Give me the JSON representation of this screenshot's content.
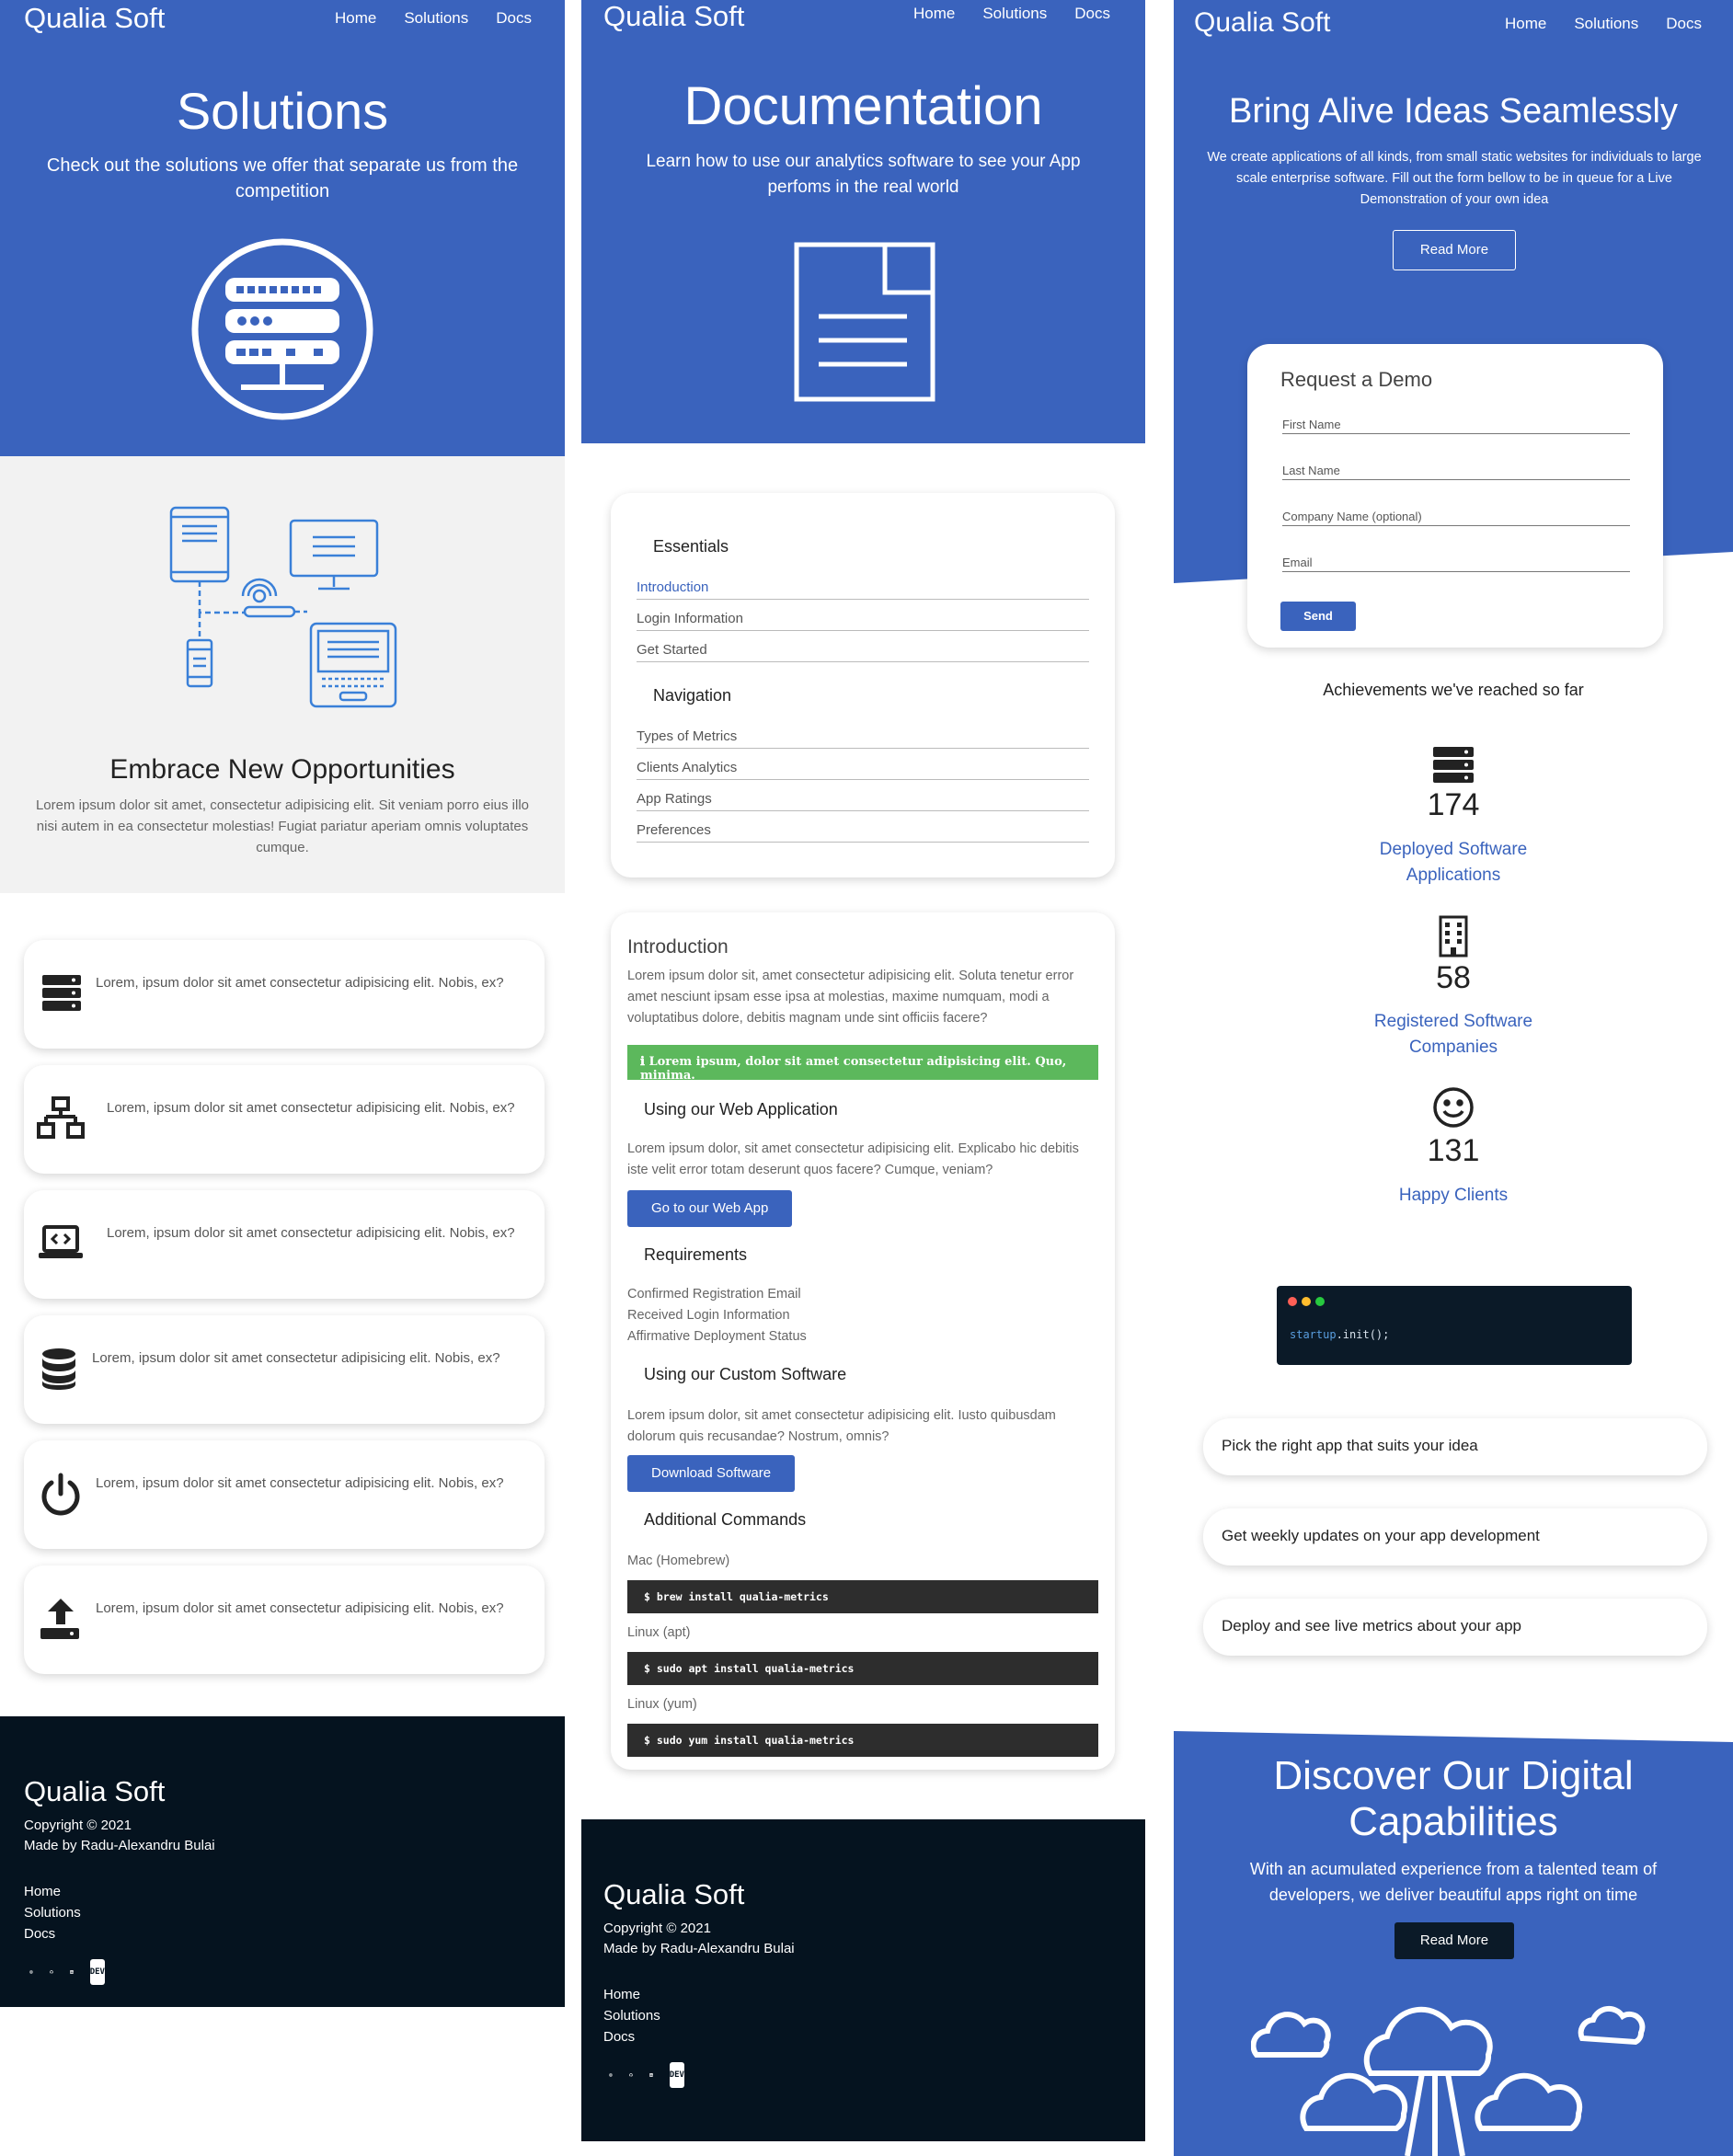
{
  "brand": "Qualia Soft",
  "nav": [
    "Home",
    "Solutions",
    "Docs"
  ],
  "colors": {
    "primary": "#3a63bd",
    "footer": "#05131f",
    "alert": "#5cb85c",
    "light_gray": "#f2f2f2"
  },
  "solutions_page": {
    "hero_title": "Solutions",
    "hero_subtitle": "Check out the solutions we offer that separate us from the competition",
    "hero_icon": "server-rack-circle-icon",
    "illustration": "connected-devices-icon",
    "section_title": "Embrace New Opportunities",
    "section_text": "Lorem ipsum dolor sit amet, consectetur adipisicing elit. Sit veniam porro eius illo nisi autem in ea consectetur molestias! Fugiat pariatur aperiam omnis voluptates cumque.",
    "features": [
      {
        "icon": "server-icon",
        "text": "Lorem, ipsum dolor sit amet consectetur adipisicing elit. Nobis, ex?"
      },
      {
        "icon": "network-icon",
        "text": "Lorem, ipsum dolor sit amet consectetur adipisicing elit. Nobis, ex?"
      },
      {
        "icon": "laptop-code-icon",
        "text": "Lorem, ipsum dolor sit amet consectetur adipisicing elit. Nobis, ex?"
      },
      {
        "icon": "database-icon",
        "text": "Lorem, ipsum dolor sit amet consectetur adipisicing elit. Nobis, ex?"
      },
      {
        "icon": "power-icon",
        "text": "Lorem, ipsum dolor sit amet consectetur adipisicing elit. Nobis, ex?"
      },
      {
        "icon": "upload-icon",
        "text": "Lorem, ipsum dolor sit amet consectetur adipisicing elit. Nobis, ex?"
      }
    ]
  },
  "docs_page": {
    "hero_title": "Documentation",
    "hero_subtitle": "Learn how to use our analytics software to see your App perfoms in the real world",
    "hero_icon": "document-icon",
    "sidebar": {
      "essentials_title": "Essentials",
      "essentials": [
        "Introduction",
        "Login Information",
        "Get Started"
      ],
      "navigation_title": "Navigation",
      "navigation": [
        "Types of Metrics",
        "Clients Analytics",
        "App Ratings",
        "Preferences"
      ]
    },
    "intro_title": "Introduction",
    "intro_text": "Lorem ipsum dolor sit, amet consectetur adipisicing elit. Soluta tenetur error amet nesciunt ipsam esse ipsa at molestias, maxime numquam, modi a voluptatibus dolore, debitis magnam unde sint officiis facere?",
    "alert_icon": "info-icon",
    "alert_text": "Lorem ipsum, dolor sit amet consectetur adipisicing elit. Quo, minima.",
    "web_title": "Using our Web Application",
    "web_text": "Lorem ipsum dolor, sit amet consectetur adipisicing elit. Explicabo hic debitis iste velit error totam deserunt quos facere? Cumque, veniam?",
    "web_button": "Go to our Web App",
    "req_title": "Requirements",
    "requirements": [
      "Confirmed Registration Email",
      "Received Login Information",
      "Affirmative Deployment Status"
    ],
    "custom_title": "Using our Custom Software",
    "custom_text": "Lorem ipsum dolor, sit amet consectetur adipisicing elit. Iusto quibusdam dolorum quis recusandae? Nostrum, omnis?",
    "custom_button": "Download Software",
    "cmd_title": "Additional Commands",
    "commands": [
      {
        "label": "Mac (Homebrew)",
        "code": "$ brew install qualia-metrics"
      },
      {
        "label": "Linux (apt)",
        "code": "$ sudo apt install qualia-metrics"
      },
      {
        "label": "Linux (yum)",
        "code": "$ sudo yum install qualia-metrics"
      }
    ]
  },
  "home_page": {
    "hero_title": "Bring Alive Ideas Seamlessly",
    "hero_subtitle": "We create applications of all kinds, from small static websites for individuals to large scale enterprise software. Fill out the form bellow to be in queue for a Live Demonstration of your own idea",
    "read_more": "Read More",
    "demo_title": "Request a Demo",
    "fields": [
      "First Name",
      "Last Name",
      "Company Name (optional)",
      "Email"
    ],
    "send": "Send",
    "achievements_title": "Achievements we've reached so far",
    "stats": [
      {
        "icon": "server-icon",
        "value": "174",
        "label_line1": "Deployed Software",
        "label_line2": "Applications"
      },
      {
        "icon": "building-icon",
        "value": "58",
        "label_line1": "Registered Software",
        "label_line2": "Companies"
      },
      {
        "icon": "smile-icon",
        "value": "131",
        "label_line1": "Happy Clients",
        "label_line2": ""
      }
    ],
    "code_obj": "startup",
    "code_rest": ".init();",
    "pills": [
      "Pick the right app that suits your idea",
      "Get weekly updates on your app development",
      "Deploy and see live metrics about your app"
    ],
    "discover_title_line1": "Discover Our Digital",
    "discover_title_line2": "Capabilities",
    "discover_text": "With an acumulated experience from a talented team of developers, we deliver beautiful apps right on time",
    "discover_button": "Read More",
    "discover_icon": "cloud-network-icon"
  },
  "footer": {
    "brand": "Qualia Soft",
    "copyright": "Copyright © 2021",
    "made_by": "Made by Radu-Alexandru Bulai",
    "links": [
      "Home",
      "Solutions",
      "Docs"
    ],
    "socials": [
      "globe-icon",
      "github-icon",
      "linkedin-icon",
      "dev-icon"
    ],
    "dev_text": "DEV"
  }
}
